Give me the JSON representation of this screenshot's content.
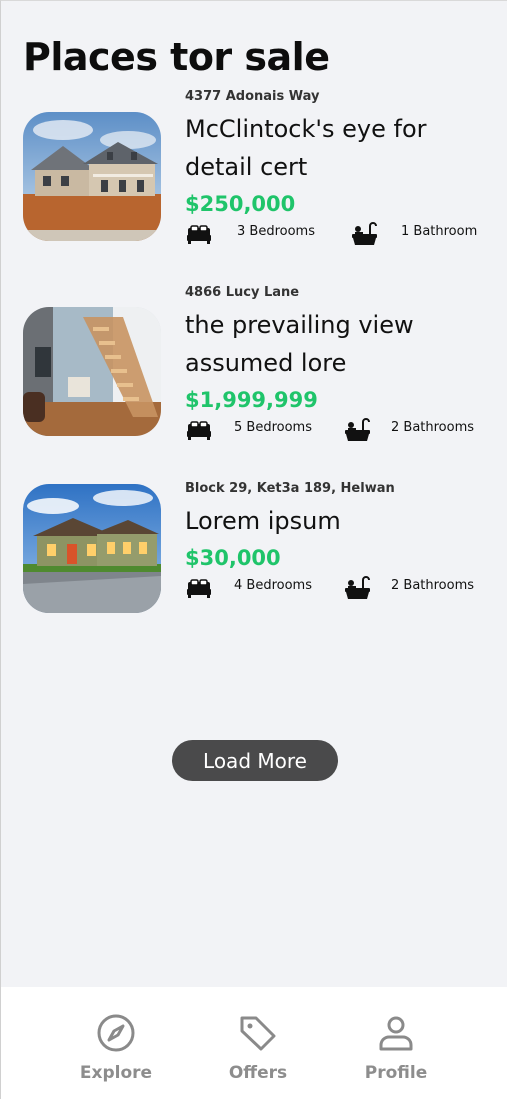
{
  "page": {
    "title": "Places tor sale"
  },
  "listings": [
    {
      "address": "4377 Adonais Way",
      "name": "McClintock's eye for detail cert",
      "price": "$250,000",
      "bedrooms": "3 Bedrooms",
      "bathrooms": "1 Bathroom"
    },
    {
      "address": "4866 Lucy Lane",
      "name": "the prevailing view assumed lore",
      "price": "$1,999,999",
      "bedrooms": "5 Bedrooms",
      "bathrooms": "2 Bathrooms"
    },
    {
      "address": "Block 29, Ket3a 189, Helwan",
      "name": "Lorem ipsum",
      "price": "$30,000",
      "bedrooms": "4 Bedrooms",
      "bathrooms": "2 Bathrooms"
    }
  ],
  "load_more": {
    "label": "Load More"
  },
  "tabbar": {
    "items": [
      {
        "label": "Explore",
        "icon": "compass-icon"
      },
      {
        "label": "Offers",
        "icon": "tag-icon"
      },
      {
        "label": "Profile",
        "icon": "user-icon"
      }
    ]
  },
  "colors": {
    "price": "#1fc46a",
    "background": "#f2f3f6",
    "button": "#4a4a4b",
    "tab": "#8d8d8d"
  }
}
